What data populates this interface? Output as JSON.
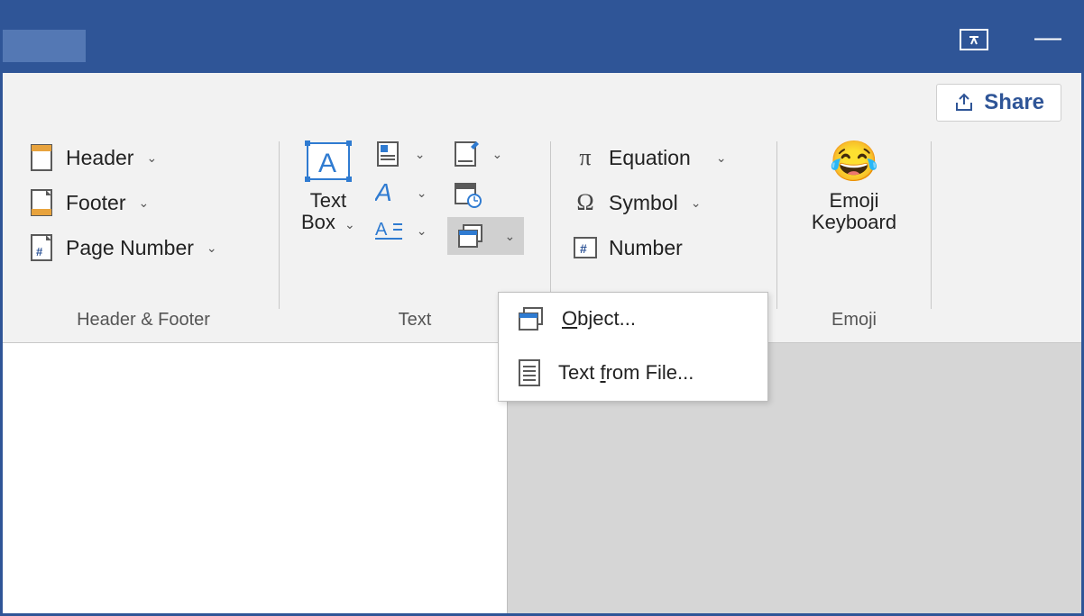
{
  "titlebar": {
    "minimize": "—"
  },
  "share": {
    "label": "Share"
  },
  "header_footer": {
    "group_label": "Header & Footer",
    "header": "Header",
    "footer": "Footer",
    "page_number": "Page Number"
  },
  "text_group": {
    "group_label": "Text",
    "text_box_line1": "Text",
    "text_box_line2": "Box"
  },
  "symbols": {
    "equation": "Equation",
    "symbol": "Symbol",
    "number": "Number"
  },
  "emoji": {
    "group_label": "Emoji",
    "label_line1": "Emoji",
    "label_line2": "Keyboard"
  },
  "object_menu": {
    "object": "Object...",
    "object_ak": "O",
    "text_from_file": "Text from File...",
    "tff_ak": "f"
  }
}
